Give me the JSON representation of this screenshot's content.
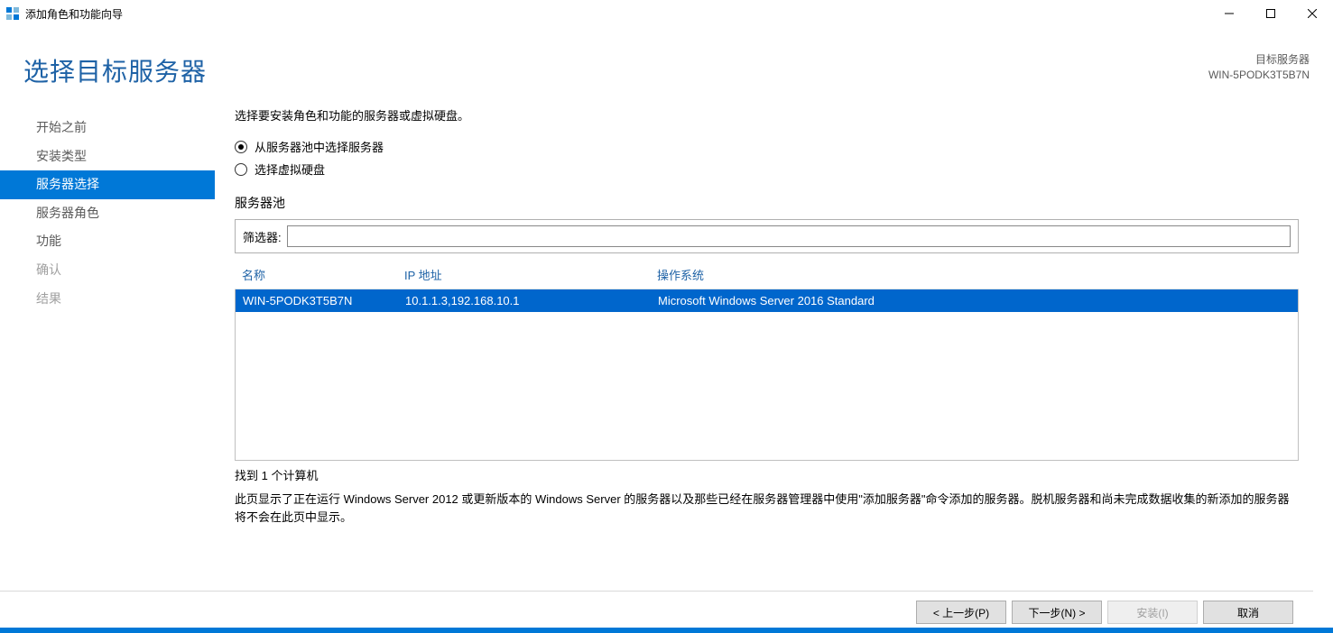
{
  "window": {
    "title": "添加角色和功能向导"
  },
  "header": {
    "pageTitle": "选择目标服务器",
    "targetLabel": "目标服务器",
    "targetValue": "WIN-5PODK3T5B7N"
  },
  "sidebar": {
    "items": [
      {
        "label": "开始之前",
        "active": false,
        "disabled": false
      },
      {
        "label": "安装类型",
        "active": false,
        "disabled": false
      },
      {
        "label": "服务器选择",
        "active": true,
        "disabled": false
      },
      {
        "label": "服务器角色",
        "active": false,
        "disabled": false
      },
      {
        "label": "功能",
        "active": false,
        "disabled": false
      },
      {
        "label": "确认",
        "active": false,
        "disabled": true
      },
      {
        "label": "结果",
        "active": false,
        "disabled": true
      }
    ]
  },
  "content": {
    "instruction": "选择要安装角色和功能的服务器或虚拟硬盘。",
    "radio1": "从服务器池中选择服务器",
    "radio2": "选择虚拟硬盘",
    "poolTitle": "服务器池",
    "filterLabel": "筛选器:",
    "filterValue": "",
    "columns": {
      "name": "名称",
      "ip": "IP 地址",
      "os": "操作系统"
    },
    "rows": [
      {
        "name": "WIN-5PODK3T5B7N",
        "ip": "10.1.1.3,192.168.10.1",
        "os": "Microsoft Windows Server 2016 Standard",
        "selected": true
      }
    ],
    "foundText": "找到 1 个计算机",
    "description": "此页显示了正在运行 Windows Server 2012 或更新版本的 Windows Server 的服务器以及那些已经在服务器管理器中使用\"添加服务器\"命令添加的服务器。脱机服务器和尚未完成数据收集的新添加的服务器将不会在此页中显示。"
  },
  "footer": {
    "prev": "< 上一步(P)",
    "next": "下一步(N) >",
    "install": "安装(I)",
    "cancel": "取消"
  }
}
